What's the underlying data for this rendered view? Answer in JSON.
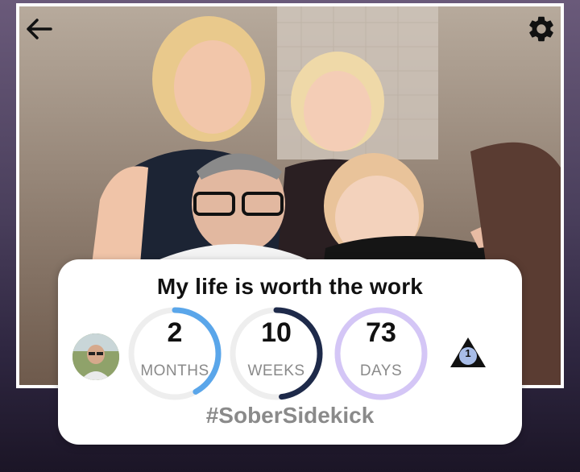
{
  "nav": {
    "back_icon": "arrow-left-icon",
    "settings_icon": "gear-icon"
  },
  "card": {
    "title": "My life is worth the work",
    "hashtag": "#SoberSidekick",
    "counters": [
      {
        "value": "2",
        "label": "MONTHS",
        "progress": 0.42,
        "color": "#5aa6ea"
      },
      {
        "value": "10",
        "label": "WEEKS",
        "progress": 0.48,
        "color": "#1e2a4a"
      },
      {
        "value": "73",
        "label": "DAYS",
        "progress": 1.0,
        "color": "#d4c6f6"
      }
    ],
    "badge": {
      "icon": "triangle-badge-icon",
      "count": "1",
      "color": "#a8bde8"
    }
  },
  "colors": {
    "ring_track": "#eeeeee",
    "card_bg": "#ffffff"
  }
}
